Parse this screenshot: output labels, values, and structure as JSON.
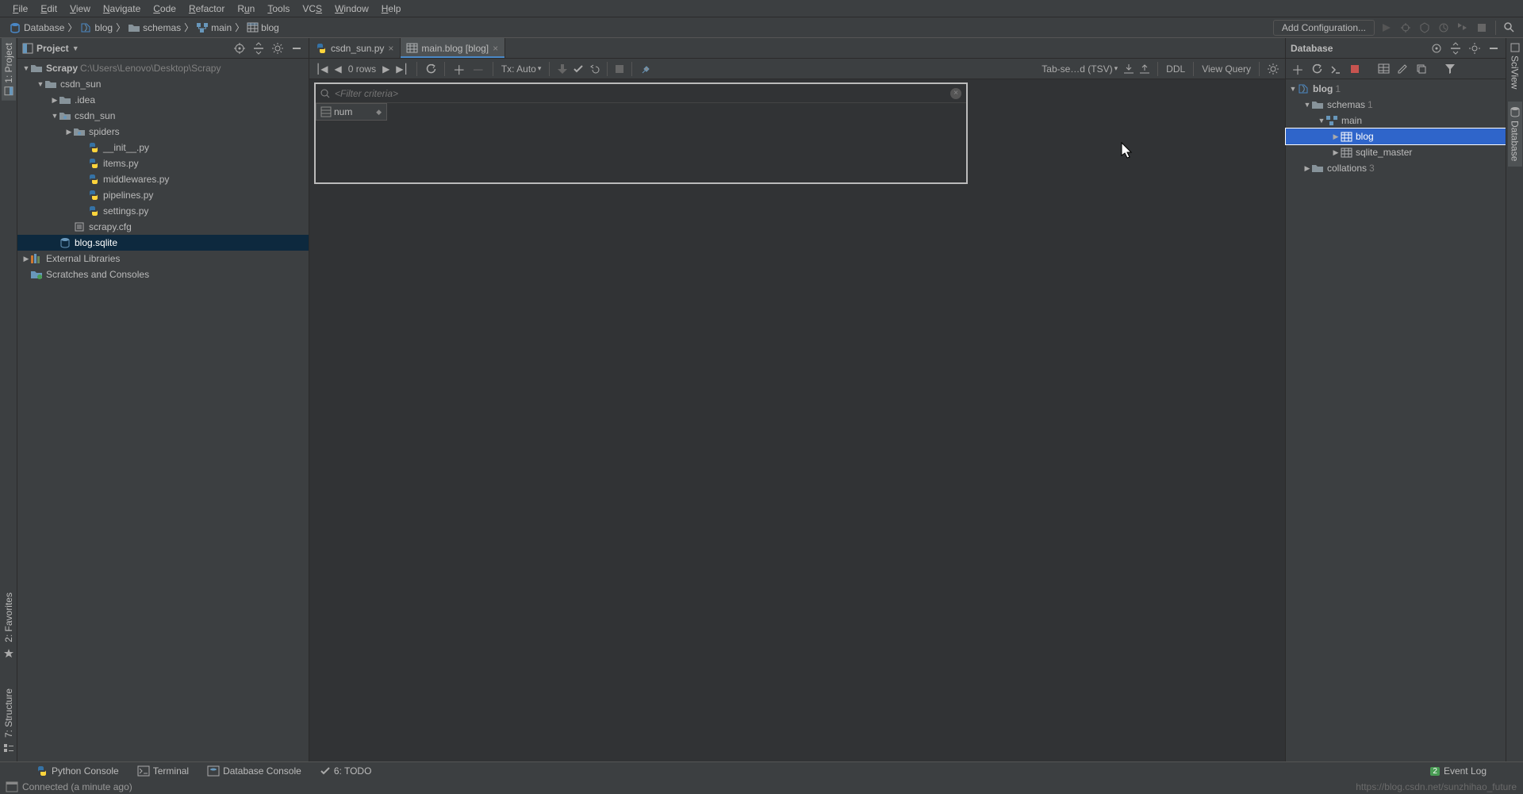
{
  "menu": [
    "File",
    "Edit",
    "View",
    "Navigate",
    "Code",
    "Refactor",
    "Run",
    "Tools",
    "VCS",
    "Window",
    "Help"
  ],
  "breadcrumb": {
    "db": "Database",
    "conn": "blog",
    "schemas": "schemas",
    "main": "main",
    "table": "blog"
  },
  "add_config": "Add Configuration...",
  "project": {
    "title": "Project",
    "root": "Scrapy",
    "root_path": "C:\\Users\\Lenovo\\Desktop\\Scrapy",
    "items": {
      "csdn_sun": "csdn_sun",
      "idea": ".idea",
      "csdn_sun2": "csdn_sun",
      "spiders": "spiders",
      "init": "__init__.py",
      "items_py": "items.py",
      "middlewares": "middlewares.py",
      "pipelines": "pipelines.py",
      "settings": "settings.py",
      "scrapy_cfg": "scrapy.cfg",
      "blog_sqlite": "blog.sqlite",
      "ext_lib": "External Libraries",
      "scratches": "Scratches and Consoles"
    }
  },
  "tabs": {
    "t1": "csdn_sun.py",
    "t2": "main.blog [blog]"
  },
  "grid_toolbar": {
    "rows": "0 rows",
    "tx": "Tx: Auto",
    "format": "Tab-se…d (TSV)",
    "ddl": "DDL",
    "view_query": "View Query"
  },
  "filter_placeholder": "<Filter criteria>",
  "column": "num",
  "db_panel": {
    "title": "Database",
    "blog": "blog",
    "blog_count": "1",
    "schemas": "schemas",
    "schemas_count": "1",
    "main": "main",
    "tbl_blog": "blog",
    "tbl_master": "sqlite_master",
    "collations": "collations",
    "collations_count": "3"
  },
  "left_tabs": {
    "project": "1: Project",
    "favorites": "2: Favorites",
    "structure": "7: Structure"
  },
  "right_tabs": {
    "database": "Database",
    "sciview": "SciView"
  },
  "bottom_tabs": {
    "py_console": "Python Console",
    "terminal": "Terminal",
    "db_console": "Database Console",
    "todo": "6: TODO",
    "event_log": "Event Log",
    "badge": "2"
  },
  "status": "Connected (a minute ago)",
  "watermark": "https://blog.csdn.net/sunzhihao_future"
}
